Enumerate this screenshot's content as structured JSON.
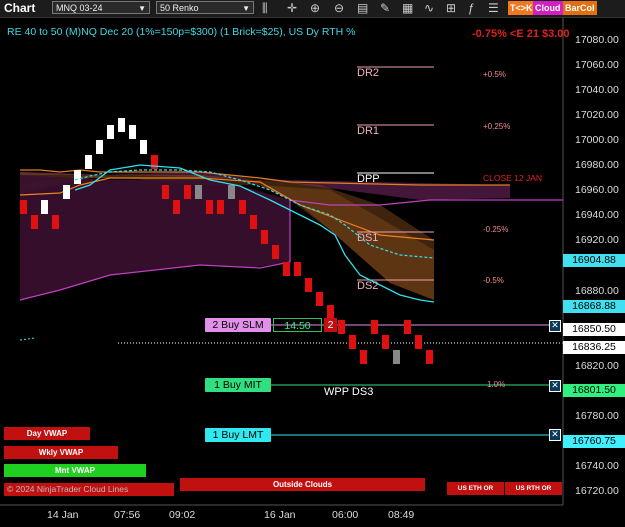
{
  "toolbar": {
    "title": "Chart",
    "instrument": "MNQ 03-24",
    "bar_type": "50 Renko",
    "tk_label": "T<>K",
    "cloud_label": "Cloud",
    "barcol_label": "BarCol",
    "icons": [
      "bar-type-icon",
      "crosshair-icon",
      "zoom-in-icon",
      "zoom-out-icon",
      "properties-icon",
      "drawing-tool-icon",
      "templates-icon",
      "strategy-icon",
      "chart-trader-icon"
    ]
  },
  "header": {
    "subtitle": "RE 40 to 50 (M)NQ Dec 20 (1%=150p=$300) (1 Brick=$25), US Dy RTH %",
    "top_pct": "-0.75% <E 21 $3.00"
  },
  "levels": [
    {
      "name": "DR2",
      "price": 17063,
      "pct": "+0.5%"
    },
    {
      "name": "DR1",
      "price": 17031,
      "pct": "+0.25%"
    },
    {
      "name": "DPP",
      "price": 16975,
      "pct": ""
    },
    {
      "name": "DS1",
      "price": 16922,
      "pct": "-0.25%"
    },
    {
      "name": "DS2",
      "price": 16893,
      "pct": "-0.5%"
    },
    {
      "name": "WPP DS3",
      "price": 16802,
      "pct": "1.0%"
    }
  ],
  "close_label": "CLOSE 12 JAN",
  "orders": {
    "slm": {
      "label": "2 Buy SLM",
      "price_field": "14.50",
      "qty": "2",
      "price": 16850.5
    },
    "mit": {
      "label": "1 Buy MIT",
      "price": 16801.5
    },
    "lmt": {
      "label": "1 Buy LMT",
      "price": 16760.75
    }
  },
  "price_tags": [
    {
      "label": "16904.88",
      "price": 16904.88,
      "color": "#40e0f0"
    },
    {
      "label": "16868.88",
      "price": 16868.88,
      "color": "#40e0f0"
    },
    {
      "label": "16850.50",
      "price": 16850.5,
      "color": "#ffffff"
    },
    {
      "label": "16836.25",
      "price": 16836.25,
      "color": "#ffffff"
    },
    {
      "label": "16801.50",
      "price": 16801.5,
      "color": "#30f080"
    },
    {
      "label": "16760.75",
      "price": 16760.75,
      "color": "#40f0ff"
    }
  ],
  "vwap": {
    "day": "Day VWAP",
    "weekly": "Wkly VWAP",
    "monthly": "Mnt VWAP"
  },
  "outside_clouds": "Outside Clouds",
  "us_eth_or": "US ETH OR",
  "us_rth_or": "US RTH OR",
  "legend_text": "© 2024 NinjaTrader Cloud Lines",
  "chart_data": {
    "type": "line",
    "title": "",
    "ylim": [
      16710,
      17090
    ],
    "y_ticks": [
      "17080.00",
      "17060.00",
      "17040.00",
      "17020.00",
      "17000.00",
      "16980.00",
      "16960.00",
      "16940.00",
      "16920.00",
      "16880.00",
      "16820.00",
      "16780.00",
      "16740.00",
      "16720.00"
    ],
    "x_ticks": [
      "14 Jan",
      "07:56",
      "09:02",
      "16 Jan",
      "06:00",
      "08:49"
    ],
    "renko_bricks": [
      {
        "i": 0,
        "dir": "down"
      },
      {
        "i": 1,
        "dir": "down"
      },
      {
        "i": 2,
        "dir": "up"
      },
      {
        "i": 3,
        "dir": "down"
      },
      {
        "i": 4,
        "dir": "up"
      },
      {
        "i": 5,
        "dir": "up"
      },
      {
        "i": 6,
        "dir": "up"
      },
      {
        "i": 7,
        "dir": "up"
      },
      {
        "i": 8,
        "dir": "up"
      },
      {
        "i": 9,
        "dir": "up"
      },
      {
        "i": 10,
        "dir": "up"
      },
      {
        "i": 11,
        "dir": "up"
      },
      {
        "i": 12,
        "dir": "down"
      },
      {
        "i": 13,
        "dir": "down"
      },
      {
        "i": 14,
        "dir": "down"
      },
      {
        "i": 15,
        "dir": "down"
      },
      {
        "i": 16,
        "dir": "up"
      },
      {
        "i": 17,
        "dir": "down"
      },
      {
        "i": 18,
        "dir": "down"
      },
      {
        "i": 19,
        "dir": "up"
      },
      {
        "i": 20,
        "dir": "down"
      },
      {
        "i": 21,
        "dir": "down"
      },
      {
        "i": 22,
        "dir": "down"
      },
      {
        "i": 23,
        "dir": "down"
      },
      {
        "i": 24,
        "dir": "down"
      },
      {
        "i": 25,
        "dir": "down"
      },
      {
        "i": 26,
        "dir": "down"
      },
      {
        "i": 27,
        "dir": "down"
      },
      {
        "i": 28,
        "dir": "down"
      },
      {
        "i": 29,
        "dir": "down"
      },
      {
        "i": 30,
        "dir": "down"
      },
      {
        "i": 31,
        "dir": "down"
      },
      {
        "i": 32,
        "dir": "down"
      },
      {
        "i": 33,
        "dir": "down"
      },
      {
        "i": 34,
        "dir": "up"
      },
      {
        "i": 35,
        "dir": "down"
      },
      {
        "i": 36,
        "dir": "down"
      },
      {
        "i": 37,
        "dir": "down"
      }
    ],
    "series": [
      {
        "name": "",
        "values": [
          16957,
          16957,
          16957,
          16957,
          16957,
          16960,
          16968,
          16975,
          16975,
          16975,
          16975,
          16975,
          16975,
          16975,
          16975,
          16972,
          16965,
          16950,
          16935,
          16920,
          16918,
          16918
        ]
      },
      {
        "name": "",
        "values": [
          16940,
          16940,
          16942,
          16945,
          16955,
          16962,
          16970,
          16973,
          16974,
          16972,
          16970,
          16955,
          16940,
          16925,
          16905,
          16890,
          16880,
          16870,
          16868
        ]
      }
    ],
    "grid": false
  }
}
